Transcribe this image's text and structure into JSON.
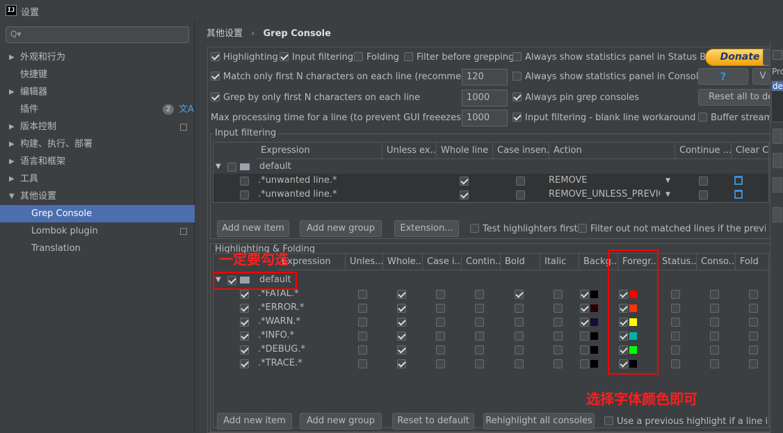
{
  "window": {
    "title": "设置",
    "app_icon": "IJ"
  },
  "search": {
    "placeholder": "Q▾"
  },
  "sidebar": {
    "items": [
      {
        "label": "外观和行为",
        "arrow": "▶"
      },
      {
        "label": "快捷键",
        "arrow": ""
      },
      {
        "label": "编辑器",
        "arrow": "▶"
      },
      {
        "label": "插件",
        "arrow": "",
        "badge": "2"
      },
      {
        "label": "版本控制",
        "arrow": "▶"
      },
      {
        "label": "构建、执行、部署",
        "arrow": "▶"
      },
      {
        "label": "语言和框架",
        "arrow": "▶"
      },
      {
        "label": "工具",
        "arrow": "▶"
      },
      {
        "label": "其他设置",
        "arrow": "▼"
      },
      {
        "label": "Grep Console",
        "arrow": ""
      },
      {
        "label": "Lombok plugin",
        "arrow": ""
      },
      {
        "label": "Translation",
        "arrow": ""
      }
    ]
  },
  "breadcrumb": {
    "parent": "其他设置",
    "sep": "›",
    "current": "Grep Console"
  },
  "options": {
    "highlighting": "Highlighting",
    "input_filtering": "Input filtering",
    "folding": "Folding",
    "filter_before": "Filter before grepping",
    "always_stats_status": "Always show statistics panel in Status Bar",
    "match_first_n": "Match only first N characters on each line (recommended)",
    "match_n_value": "120",
    "always_stats_console": "Always show statistics panel in Console",
    "grep_first_n": "Grep by only first N characters on each line",
    "grep_n_value": "1000",
    "always_pin": "Always pin grep consoles",
    "max_time": "Max processing time for a line (to prevent GUI freeezes) [ms]",
    "max_time_value": "1000",
    "blank_workaround": "Input filtering - blank line workaround",
    "buffer": "Buffer stream",
    "donate": "Donate",
    "help": "?",
    "reset_all": "Reset all to de",
    "v_btn": "V"
  },
  "input_filtering": {
    "title": "Input filtering",
    "headers": [
      "Expression",
      "Unless ex...",
      "Whole line",
      "Case insen...",
      "Action",
      "Continue ...",
      "Clear C"
    ],
    "group": "default",
    "rows": [
      {
        "expr": ".*unwanted line.*",
        "action": "REMOVE"
      },
      {
        "expr": ".*unwanted line.*",
        "action": "REMOVE_UNLESS_PREVIO..."
      }
    ],
    "buttons": [
      "Add new item",
      "Add new group",
      "Extension..."
    ],
    "test_first": "Test highlighters first",
    "filter_out": "Filter out not matched lines if the previous"
  },
  "highlighting": {
    "title": "Highlighting & Folding",
    "headers": [
      "Expression",
      "Unles...",
      "Whole...",
      "Case i...",
      "Contin...",
      "Bold",
      "Italic",
      "Backg...",
      "Foregr...",
      "Status...",
      "Conso...",
      "Fold"
    ],
    "group": "default",
    "rows": [
      {
        "expr": ".*FATAL.*",
        "bold": true,
        "bg_on": true,
        "bg": "#000000",
        "fg": "#ff0000"
      },
      {
        "expr": ".*ERROR.*",
        "bold": false,
        "bg_on": true,
        "bg": "#2b0000",
        "fg": "#ff3300"
      },
      {
        "expr": ".*WARN.*",
        "bold": false,
        "bg_on": true,
        "bg": "#1a0a3a",
        "fg": "#ffff00"
      },
      {
        "expr": ".*INFO.*",
        "bold": false,
        "bg_on": false,
        "bg": "#000000",
        "fg": "#00b3a6"
      },
      {
        "expr": ".*DEBUG.*",
        "bold": false,
        "bg_on": false,
        "bg": "#000000",
        "fg": "#00ff00"
      },
      {
        "expr": ".*TRACE.*",
        "bold": false,
        "bg_on": false,
        "bg": "#000000",
        "fg": "#000000"
      }
    ],
    "buttons": [
      "Add new item",
      "Add new group",
      "Reset to default",
      "Rehighlight all consoles"
    ],
    "use_previous": "Use a previous highlight if a line is n"
  },
  "annotations": {
    "must_check": "一定要勾选",
    "choose_color": "选择字体颜色即可"
  },
  "right_panel": {
    "label1": "Pro",
    "label2": "de"
  }
}
